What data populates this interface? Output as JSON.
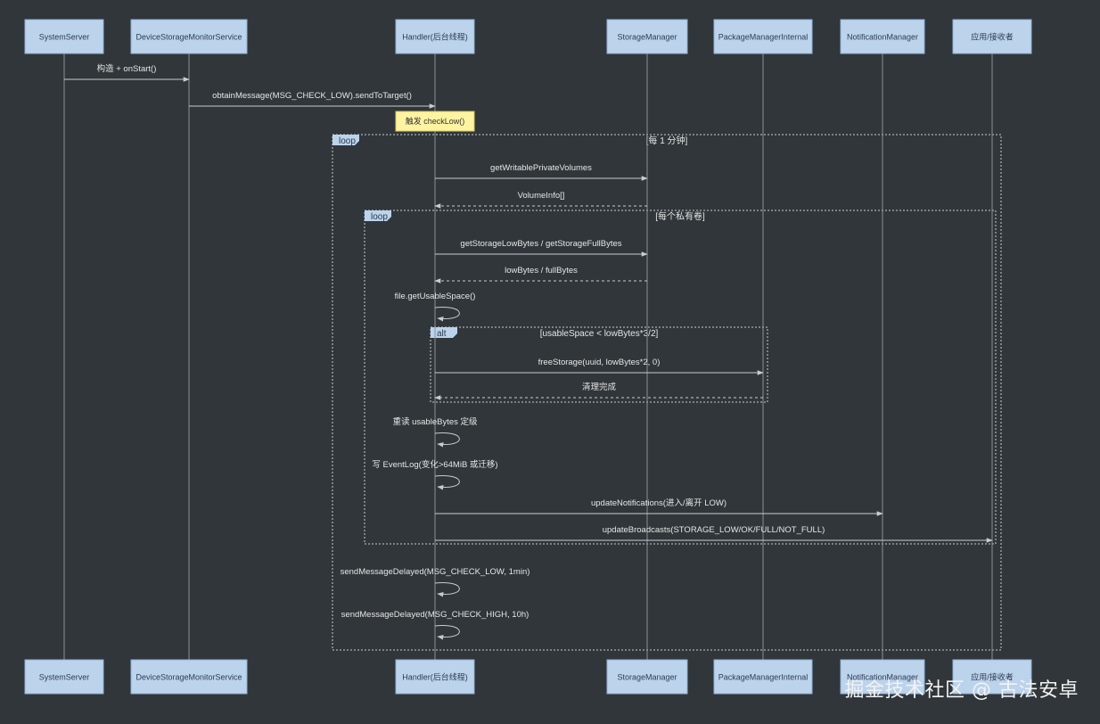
{
  "participants": [
    {
      "id": "sys",
      "label": "SystemServer"
    },
    {
      "id": "dsms",
      "label": "DeviceStorageMonitorService"
    },
    {
      "id": "handler",
      "label": "Handler(后台线程)"
    },
    {
      "id": "sm",
      "label": "StorageManager"
    },
    {
      "id": "pmi",
      "label": "PackageManagerInternal"
    },
    {
      "id": "nm",
      "label": "NotificationManager"
    },
    {
      "id": "app",
      "label": "应用/接收者"
    }
  ],
  "messages": [
    {
      "from": "sys",
      "to": "dsms",
      "label": "构造 + onStart()",
      "style": "solid"
    },
    {
      "from": "dsms",
      "to": "handler",
      "label": "obtainMessage(MSG_CHECK_LOW).sendToTarget()",
      "style": "solid"
    },
    {
      "from": "handler",
      "to": "sm",
      "label": "getWritablePrivateVolumes",
      "style": "solid"
    },
    {
      "from": "sm",
      "to": "handler",
      "label": "VolumeInfo[]",
      "style": "dashed"
    },
    {
      "from": "handler",
      "to": "sm",
      "label": "getStorageLowBytes / getStorageFullBytes",
      "style": "solid"
    },
    {
      "from": "sm",
      "to": "handler",
      "label": "lowBytes / fullBytes",
      "style": "dashed"
    },
    {
      "from": "handler",
      "to": "handler",
      "label": "file.getUsableSpace()",
      "style": "self"
    },
    {
      "from": "handler",
      "to": "pmi",
      "label": "freeStorage(uuid, lowBytes*2, 0)",
      "style": "solid"
    },
    {
      "from": "pmi",
      "to": "handler",
      "label": "清理完成",
      "style": "dashed"
    },
    {
      "from": "handler",
      "to": "handler",
      "label": "重读 usableBytes 定级",
      "style": "self"
    },
    {
      "from": "handler",
      "to": "handler",
      "label": "写 EventLog(变化>64MiB 或迁移)",
      "style": "self"
    },
    {
      "from": "handler",
      "to": "nm",
      "label": "updateNotifications(进入/离开 LOW)",
      "style": "solid"
    },
    {
      "from": "handler",
      "to": "app",
      "label": "updateBroadcasts(STORAGE_LOW/OK/FULL/NOT_FULL)",
      "style": "solid"
    },
    {
      "from": "handler",
      "to": "handler",
      "label": "sendMessageDelayed(MSG_CHECK_LOW, 1min)",
      "style": "self"
    },
    {
      "from": "handler",
      "to": "handler",
      "label": "sendMessageDelayed(MSG_CHECK_HIGH, 10h)",
      "style": "self"
    }
  ],
  "note": {
    "over": "handler",
    "label": "触发 checkLow()"
  },
  "fragments": [
    {
      "kind": "loop",
      "condition": "[每 1 分钟]"
    },
    {
      "kind": "loop",
      "condition": "[每个私有卷]"
    },
    {
      "kind": "alt",
      "condition": "[usableSpace < lowBytes*3/2]"
    }
  ],
  "watermark": "掘金技术社区 @ 古法安卓",
  "colors": {
    "background": "#30363a",
    "participant_fill": "#bcd3ec",
    "participant_stroke": "#8fb0d4",
    "lifeline": "#8a9096",
    "arrow": "#c8ccd0",
    "text": "#e6e6e6",
    "note_fill": "#fdf3a0",
    "fragment_border": "#c8ccd0",
    "fragment_tag_fill": "#bcd3ec"
  }
}
